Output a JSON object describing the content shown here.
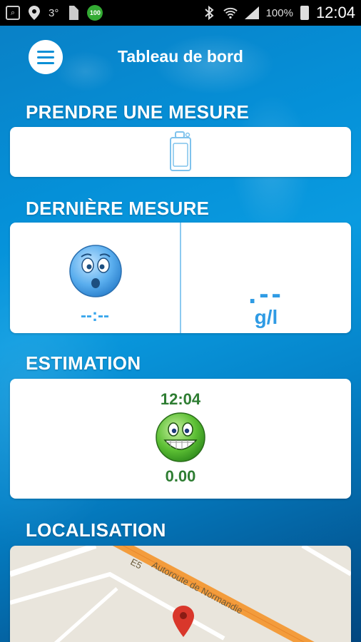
{
  "status_bar": {
    "icons": [
      "app-icon",
      "location-icon",
      "temp-icon",
      "sim-icon",
      "badge-icon",
      "bluetooth-icon",
      "wifi-icon",
      "signal-icon",
      "battery-icon"
    ],
    "temp_text": "3°",
    "badge_text": "100",
    "battery_percent": "100%",
    "time": "12:04"
  },
  "header": {
    "title": "Tableau de bord"
  },
  "sections": {
    "take_measure": "PRENDRE UNE MESURE",
    "last_measure": "DERNIÈRE MESURE",
    "estimation": "ESTIMATION",
    "location": "LOCALISATION"
  },
  "last_measure": {
    "time": "--:--",
    "value": ".--",
    "unit": "g/l"
  },
  "estimation": {
    "time": "12:04",
    "value": "0.00"
  },
  "map": {
    "road_code": "E5",
    "road_name": "Autoroute de Normandie"
  },
  "colors": {
    "accent": "#2f9be4",
    "estimation_green": "#2e7d32",
    "map_road": "#f39c3c",
    "pin": "#d9372b"
  }
}
